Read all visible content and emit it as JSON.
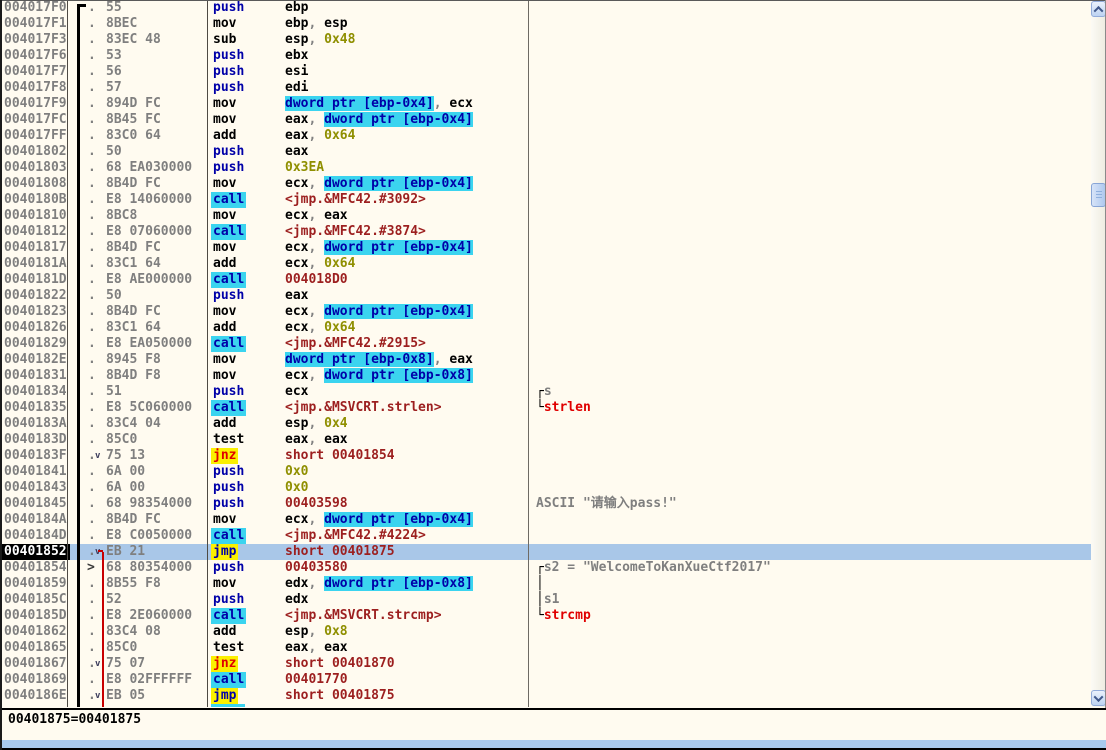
{
  "palette": {
    "background": "#FFFBF0",
    "gray_text": "#7F7F7F",
    "navy": "#0000A8",
    "immediate_olive": "#8F8F00",
    "address_maroon": "#9C1F1F",
    "function_red": "#E00000",
    "highlight_cyan": "#3BD4EF",
    "highlight_yellow": "#FBF000",
    "selected_row_blue": "#A9C7E8",
    "jump_line_red": "#C80000"
  },
  "disassembly": {
    "rows": [
      {
        "address": "004017F0",
        "marker": "dot",
        "hex": "55",
        "mnemonic": "push",
        "mnemonic_style": "push",
        "operands": [
          [
            "ebp",
            "reg"
          ]
        ],
        "comment": []
      },
      {
        "address": "004017F1",
        "marker": "dot",
        "hex": "8BEC",
        "mnemonic": "mov",
        "mnemonic_style": "plain",
        "operands": [
          [
            "ebp",
            "reg"
          ],
          [
            ", ",
            "sep"
          ],
          [
            "esp",
            "reg"
          ]
        ],
        "comment": []
      },
      {
        "address": "004017F3",
        "marker": "dot",
        "hex": "83EC 48",
        "mnemonic": "sub",
        "mnemonic_style": "plain",
        "operands": [
          [
            "esp",
            "reg"
          ],
          [
            ", ",
            "sep"
          ],
          [
            "0x48",
            "imm"
          ]
        ],
        "comment": []
      },
      {
        "address": "004017F6",
        "marker": "dot",
        "hex": "53",
        "mnemonic": "push",
        "mnemonic_style": "push",
        "operands": [
          [
            "ebx",
            "reg"
          ]
        ],
        "comment": []
      },
      {
        "address": "004017F7",
        "marker": "dot",
        "hex": "56",
        "mnemonic": "push",
        "mnemonic_style": "push",
        "operands": [
          [
            "esi",
            "reg"
          ]
        ],
        "comment": []
      },
      {
        "address": "004017F8",
        "marker": "dot",
        "hex": "57",
        "mnemonic": "push",
        "mnemonic_style": "push",
        "operands": [
          [
            "edi",
            "reg"
          ]
        ],
        "comment": []
      },
      {
        "address": "004017F9",
        "marker": "dot",
        "hex": "894D FC",
        "mnemonic": "mov",
        "mnemonic_style": "plain",
        "operands": [
          [
            "dword ptr [ebp-0x4]",
            "mem"
          ],
          [
            ", ",
            "sep"
          ],
          [
            "ecx",
            "reg"
          ]
        ],
        "comment": []
      },
      {
        "address": "004017FC",
        "marker": "dot",
        "hex": "8B45 FC",
        "mnemonic": "mov",
        "mnemonic_style": "plain",
        "operands": [
          [
            "eax",
            "reg"
          ],
          [
            ", ",
            "sep"
          ],
          [
            "dword ptr [ebp-0x4]",
            "mem"
          ]
        ],
        "comment": []
      },
      {
        "address": "004017FF",
        "marker": "dot",
        "hex": "83C0 64",
        "mnemonic": "add",
        "mnemonic_style": "plain",
        "operands": [
          [
            "eax",
            "reg"
          ],
          [
            ", ",
            "sep"
          ],
          [
            "0x64",
            "imm"
          ]
        ],
        "comment": []
      },
      {
        "address": "00401802",
        "marker": "dot",
        "hex": "50",
        "mnemonic": "push",
        "mnemonic_style": "push",
        "operands": [
          [
            "eax",
            "reg"
          ]
        ],
        "comment": []
      },
      {
        "address": "00401803",
        "marker": "dot",
        "hex": "68 EA030000",
        "mnemonic": "push",
        "mnemonic_style": "push",
        "operands": [
          [
            "0x3EA",
            "imm"
          ]
        ],
        "comment": []
      },
      {
        "address": "00401808",
        "marker": "dot",
        "hex": "8B4D FC",
        "mnemonic": "mov",
        "mnemonic_style": "plain",
        "operands": [
          [
            "ecx",
            "reg"
          ],
          [
            ", ",
            "sep"
          ],
          [
            "dword ptr [ebp-0x4]",
            "mem"
          ]
        ],
        "comment": []
      },
      {
        "address": "0040180B",
        "marker": "dot",
        "hex": "E8 14060000",
        "mnemonic": "call",
        "mnemonic_style": "call",
        "operands": [
          [
            "<jmp.&MFC42.#3092>",
            "addr"
          ]
        ],
        "comment": []
      },
      {
        "address": "00401810",
        "marker": "dot",
        "hex": "8BC8",
        "mnemonic": "mov",
        "mnemonic_style": "plain",
        "operands": [
          [
            "ecx",
            "reg"
          ],
          [
            ", ",
            "sep"
          ],
          [
            "eax",
            "reg"
          ]
        ],
        "comment": []
      },
      {
        "address": "00401812",
        "marker": "dot",
        "hex": "E8 07060000",
        "mnemonic": "call",
        "mnemonic_style": "call",
        "operands": [
          [
            "<jmp.&MFC42.#3874>",
            "addr"
          ]
        ],
        "comment": []
      },
      {
        "address": "00401817",
        "marker": "dot",
        "hex": "8B4D FC",
        "mnemonic": "mov",
        "mnemonic_style": "plain",
        "operands": [
          [
            "ecx",
            "reg"
          ],
          [
            ", ",
            "sep"
          ],
          [
            "dword ptr [ebp-0x4]",
            "mem"
          ]
        ],
        "comment": []
      },
      {
        "address": "0040181A",
        "marker": "dot",
        "hex": "83C1 64",
        "mnemonic": "add",
        "mnemonic_style": "plain",
        "operands": [
          [
            "ecx",
            "reg"
          ],
          [
            ", ",
            "sep"
          ],
          [
            "0x64",
            "imm"
          ]
        ],
        "comment": []
      },
      {
        "address": "0040181D",
        "marker": "dot",
        "hex": "E8 AE000000",
        "mnemonic": "call",
        "mnemonic_style": "call",
        "operands": [
          [
            "004018D0",
            "addr"
          ]
        ],
        "comment": []
      },
      {
        "address": "00401822",
        "marker": "dot",
        "hex": "50",
        "mnemonic": "push",
        "mnemonic_style": "push",
        "operands": [
          [
            "eax",
            "reg"
          ]
        ],
        "comment": []
      },
      {
        "address": "00401823",
        "marker": "dot",
        "hex": "8B4D FC",
        "mnemonic": "mov",
        "mnemonic_style": "plain",
        "operands": [
          [
            "ecx",
            "reg"
          ],
          [
            ", ",
            "sep"
          ],
          [
            "dword ptr [ebp-0x4]",
            "mem"
          ]
        ],
        "comment": []
      },
      {
        "address": "00401826",
        "marker": "dot",
        "hex": "83C1 64",
        "mnemonic": "add",
        "mnemonic_style": "plain",
        "operands": [
          [
            "ecx",
            "reg"
          ],
          [
            ", ",
            "sep"
          ],
          [
            "0x64",
            "imm"
          ]
        ],
        "comment": []
      },
      {
        "address": "00401829",
        "marker": "dot",
        "hex": "E8 EA050000",
        "mnemonic": "call",
        "mnemonic_style": "call",
        "operands": [
          [
            "<jmp.&MFC42.#2915>",
            "addr"
          ]
        ],
        "comment": []
      },
      {
        "address": "0040182E",
        "marker": "dot",
        "hex": "8945 F8",
        "mnemonic": "mov",
        "mnemonic_style": "plain",
        "operands": [
          [
            "dword ptr [ebp-0x8]",
            "mem"
          ],
          [
            ", ",
            "sep"
          ],
          [
            "eax",
            "reg"
          ]
        ],
        "comment": []
      },
      {
        "address": "00401831",
        "marker": "dot",
        "hex": "8B4D F8",
        "mnemonic": "mov",
        "mnemonic_style": "plain",
        "operands": [
          [
            "ecx",
            "reg"
          ],
          [
            ", ",
            "sep"
          ],
          [
            "dword ptr [ebp-0x8]",
            "mem"
          ]
        ],
        "comment": []
      },
      {
        "address": "00401834",
        "marker": "dot",
        "hex": "51",
        "mnemonic": "push",
        "mnemonic_style": "push",
        "operands": [
          [
            "ecx",
            "reg"
          ]
        ],
        "comment": [
          [
            "┌",
            "bracket"
          ],
          [
            "s",
            "label"
          ]
        ]
      },
      {
        "address": "00401835",
        "marker": "dot",
        "hex": "E8 5C060000",
        "mnemonic": "call",
        "mnemonic_style": "call",
        "operands": [
          [
            "<jmp.&MSVCRT.strlen>",
            "addr"
          ]
        ],
        "comment": [
          [
            "└",
            "bracket"
          ],
          [
            "strlen",
            "func"
          ]
        ]
      },
      {
        "address": "0040183A",
        "marker": "dot",
        "hex": "83C4 04",
        "mnemonic": "add",
        "mnemonic_style": "plain",
        "operands": [
          [
            "esp",
            "reg"
          ],
          [
            ", ",
            "sep"
          ],
          [
            "0x4",
            "imm"
          ]
        ],
        "comment": []
      },
      {
        "address": "0040183D",
        "marker": "dot",
        "hex": "85C0",
        "mnemonic": "test",
        "mnemonic_style": "plain",
        "operands": [
          [
            "eax",
            "reg"
          ],
          [
            ", ",
            "sep"
          ],
          [
            "eax",
            "reg"
          ]
        ],
        "comment": []
      },
      {
        "address": "0040183F",
        "marker": "dotarrow",
        "hex": "75 13",
        "mnemonic": "jnz",
        "mnemonic_style": "jcc",
        "operands": [
          [
            "short 00401854",
            "addr"
          ]
        ],
        "comment": []
      },
      {
        "address": "00401841",
        "marker": "dot",
        "hex": "6A 00",
        "mnemonic": "push",
        "mnemonic_style": "push",
        "operands": [
          [
            "0x0",
            "imm"
          ]
        ],
        "comment": []
      },
      {
        "address": "00401843",
        "marker": "dot",
        "hex": "6A 00",
        "mnemonic": "push",
        "mnemonic_style": "push",
        "operands": [
          [
            "0x0",
            "imm"
          ]
        ],
        "comment": []
      },
      {
        "address": "00401845",
        "marker": "dot",
        "hex": "68 98354000",
        "mnemonic": "push",
        "mnemonic_style": "push",
        "operands": [
          [
            "00403598",
            "addr"
          ]
        ],
        "comment": [
          [
            "ASCII \"请输入pass!\"",
            "label"
          ]
        ]
      },
      {
        "address": "0040184A",
        "marker": "dot",
        "hex": "8B4D FC",
        "mnemonic": "mov",
        "mnemonic_style": "plain",
        "operands": [
          [
            "ecx",
            "reg"
          ],
          [
            ", ",
            "sep"
          ],
          [
            "dword ptr [ebp-0x4]",
            "mem"
          ]
        ],
        "comment": []
      },
      {
        "address": "0040184D",
        "marker": "dot",
        "hex": "E8 C0050000",
        "mnemonic": "call",
        "mnemonic_style": "call",
        "operands": [
          [
            "<jmp.&MFC42.#4224>",
            "addr"
          ]
        ],
        "comment": []
      },
      {
        "address": "00401852",
        "marker": "dotarrow",
        "hex": "EB 21",
        "mnemonic": "jmp",
        "mnemonic_style": "jmp",
        "operands": [
          [
            "short 00401875",
            "addr"
          ]
        ],
        "comment": [],
        "selected": true
      },
      {
        "address": "00401854",
        "marker": "gt",
        "hex": "68 80354000",
        "mnemonic": "push",
        "mnemonic_style": "push",
        "operands": [
          [
            "00403580",
            "addr"
          ]
        ],
        "comment": [
          [
            "┌",
            "bracket"
          ],
          [
            "s2 = \"WelcomeToKanXueCtf2017\"",
            "label"
          ]
        ]
      },
      {
        "address": "00401859",
        "marker": "dot",
        "hex": "8B55 F8",
        "mnemonic": "mov",
        "mnemonic_style": "plain",
        "operands": [
          [
            "edx",
            "reg"
          ],
          [
            ", ",
            "sep"
          ],
          [
            "dword ptr [ebp-0x8]",
            "mem"
          ]
        ],
        "comment": [
          [
            "│",
            "bracket"
          ]
        ]
      },
      {
        "address": "0040185C",
        "marker": "dot",
        "hex": "52",
        "mnemonic": "push",
        "mnemonic_style": "push",
        "operands": [
          [
            "edx",
            "reg"
          ]
        ],
        "comment": [
          [
            "│",
            "bracket"
          ],
          [
            "s1",
            "label"
          ]
        ]
      },
      {
        "address": "0040185D",
        "marker": "dot",
        "hex": "E8 2E060000",
        "mnemonic": "call",
        "mnemonic_style": "call",
        "operands": [
          [
            "<jmp.&MSVCRT.strcmp>",
            "addr"
          ]
        ],
        "comment": [
          [
            "└",
            "bracket"
          ],
          [
            "strcmp",
            "func"
          ]
        ]
      },
      {
        "address": "00401862",
        "marker": "dot",
        "hex": "83C4 08",
        "mnemonic": "add",
        "mnemonic_style": "plain",
        "operands": [
          [
            "esp",
            "reg"
          ],
          [
            ", ",
            "sep"
          ],
          [
            "0x8",
            "imm"
          ]
        ],
        "comment": []
      },
      {
        "address": "00401865",
        "marker": "dot",
        "hex": "85C0",
        "mnemonic": "test",
        "mnemonic_style": "plain",
        "operands": [
          [
            "eax",
            "reg"
          ],
          [
            ", ",
            "sep"
          ],
          [
            "eax",
            "reg"
          ]
        ],
        "comment": []
      },
      {
        "address": "00401867",
        "marker": "dotarrow",
        "hex": "75 07",
        "mnemonic": "jnz",
        "mnemonic_style": "jcc",
        "operands": [
          [
            "short 00401870",
            "addr"
          ]
        ],
        "comment": []
      },
      {
        "address": "00401869",
        "marker": "dot",
        "hex": "E8 02FFFFFF",
        "mnemonic": "call",
        "mnemonic_style": "call",
        "operands": [
          [
            "00401770",
            "addr"
          ]
        ],
        "comment": []
      },
      {
        "address": "0040186E",
        "marker": "dotarrow",
        "hex": "EB 05",
        "mnemonic": "jmp",
        "mnemonic_style": "jmp",
        "operands": [
          [
            "short 00401875",
            "addr"
          ]
        ],
        "comment": []
      }
    ]
  },
  "info_pane": {
    "text": "00401875=00401875"
  }
}
